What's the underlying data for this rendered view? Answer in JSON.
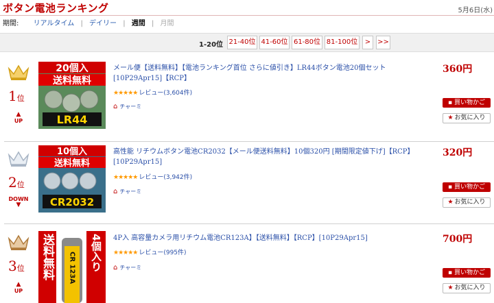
{
  "header": {
    "title": "ボタン電池ランキング",
    "date": "5月6日(水)"
  },
  "period": {
    "label": "期間:",
    "items": [
      "リアルタイム",
      "デイリー",
      "週間",
      "月間"
    ],
    "separator": "|"
  },
  "pager": {
    "current": "1-20位",
    "links": [
      "21-40位",
      "41-60位",
      "61-80位",
      "81-100位",
      ">",
      ">>"
    ]
  },
  "items": [
    {
      "rank": "1",
      "rank_suffix": "位",
      "trend": "UP",
      "trend_arrow": "▲",
      "title": "メール便【送料無料】【電池ランキング首位 さらに値引き】LR44ボタン電池20個セット[10P29Apr15]【RCP】",
      "stars": "★★★★★",
      "review": "レビュー(3,604件)",
      "shop": "チャーミ",
      "price": "360円",
      "cart": "買い物かご",
      "favorite": "お気に入り",
      "thumb_lines": [
        "20個入",
        "送料無料"
      ],
      "thumb_model": "LR44"
    },
    {
      "rank": "2",
      "rank_suffix": "位",
      "trend": "DOWN",
      "trend_arrow": "▼",
      "title": "高性能 リチウムボタン電池CR2032【メール便送料無料】10個320円 [期間限定値下げ]【RCP】[10P29Apr15]",
      "stars": "★★★★★",
      "review": "レビュー(3,942件)",
      "shop": "チャーミ",
      "price": "320円",
      "cart": "買い物かご",
      "favorite": "お気に入り",
      "thumb_lines": [
        "10個入",
        "送料無料"
      ],
      "thumb_model": "CR2032"
    },
    {
      "rank": "3",
      "rank_suffix": "位",
      "trend": "UP",
      "trend_arrow": "▲",
      "title": "4P入 高容量カメラ用リチウム電池CR123A】【送料無料】【RCP】[10P29Apr15]",
      "stars": "★★★★★",
      "review": "レビュー(995件)",
      "shop": "チャーミ",
      "price": "700円",
      "cart": "買い物かご",
      "favorite": "お気に入り",
      "thumb_lines": [
        "送料無料",
        "4個入り"
      ],
      "thumb_model": "CR 123A"
    }
  ],
  "colors": {
    "accent": "#bf0000",
    "link": "#2a4fa8",
    "gold": "#d4a017",
    "silver": "#a7b4c4",
    "bronze": "#b07a3a"
  },
  "icons": {
    "crown": "crown-icon",
    "shop": "house-icon",
    "favorite": "star-icon",
    "cart": "cart-icon"
  }
}
